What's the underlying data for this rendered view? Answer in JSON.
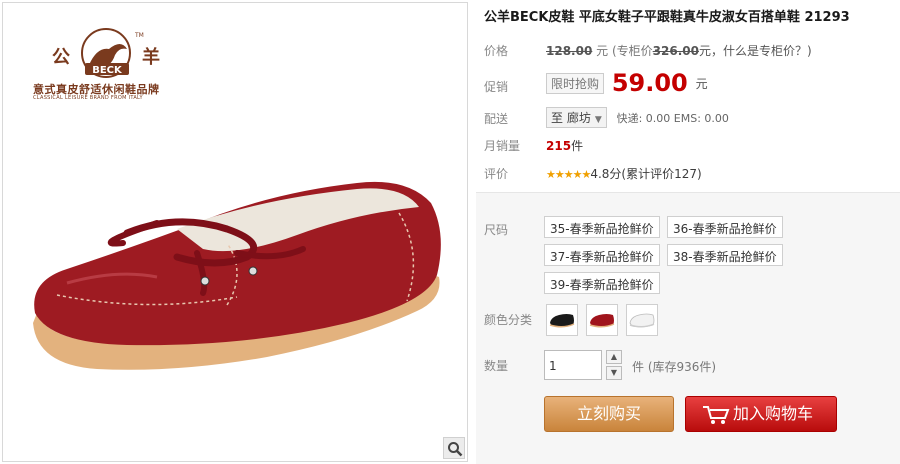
{
  "product": {
    "title": "公羊BECK皮鞋 平底女鞋子平跟鞋真牛皮淑女百搭单鞋 21293",
    "brand_cn_left": "公",
    "brand_cn_right": "羊",
    "brand_latin": "BECK",
    "brand_tm": "TM",
    "brand_slogan_cn": "意式真皮舒适休闲鞋品牌",
    "brand_slogan_en": "CLASSICAL LEISURE BRAND FROM ITALY",
    "shoe_color": "#9e1b22"
  },
  "price": {
    "label": "价格",
    "original": "128.00",
    "yuan": "元",
    "counter_open": "(专柜价",
    "counter_price": "326.00",
    "counter_close": "元，什么是专柜价？)"
  },
  "promo": {
    "label": "促销",
    "tag": "限时抢购",
    "price": "59.00",
    "yuan": "元"
  },
  "shipping": {
    "label": "配送",
    "prefix": "至",
    "city": "廊坊",
    "info": "快递: 0.00 EMS: 0.00"
  },
  "sales": {
    "label": "月销量",
    "count": "215",
    "unit": "件"
  },
  "rating": {
    "label": "评价",
    "stars": "★★★★★",
    "score": "4.8分(累计评价127)"
  },
  "options": {
    "size_label": "尺码",
    "sizes": [
      "35-春季新品抢鲜价",
      "36-春季新品抢鲜价",
      "37-春季新品抢鲜价",
      "38-春季新品抢鲜价",
      "39-春季新品抢鲜价"
    ],
    "color_label": "颜色分类",
    "colors": [
      "#1a1a1a",
      "#a0141c",
      "#f2f2f2"
    ]
  },
  "quantity": {
    "label": "数量",
    "value": "1",
    "up": "▲",
    "down": "▼",
    "stock": "件 (库存936件)"
  },
  "actions": {
    "buy": "立刻购买",
    "cart": "加入购物车"
  }
}
